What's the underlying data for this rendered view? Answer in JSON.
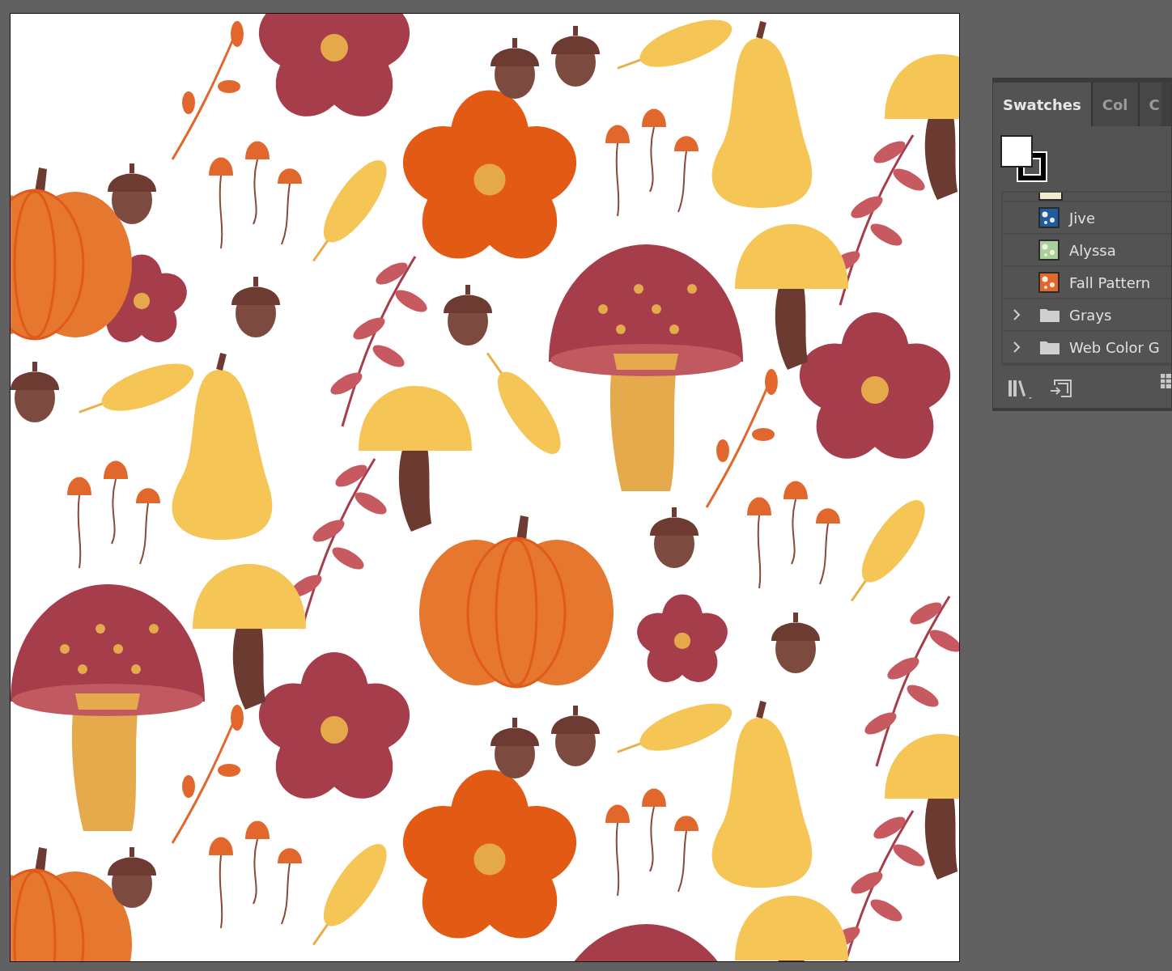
{
  "tabs": [
    {
      "label": "Swatches",
      "selected": true
    },
    {
      "label": "Col",
      "selected": false
    },
    {
      "label": "C",
      "selected": false
    }
  ],
  "swatches": [
    {
      "kind": "pattern",
      "name": "Jive",
      "color": "#1f5c9e"
    },
    {
      "kind": "pattern",
      "name": "Alyssa",
      "color": "#a9cf9c"
    },
    {
      "kind": "pattern",
      "name": "Fall Pattern",
      "color": "#e2672c"
    },
    {
      "kind": "folder",
      "name": "Grays",
      "expanded": false
    },
    {
      "kind": "folder",
      "name": "Web Color G",
      "expanded": false
    }
  ]
}
